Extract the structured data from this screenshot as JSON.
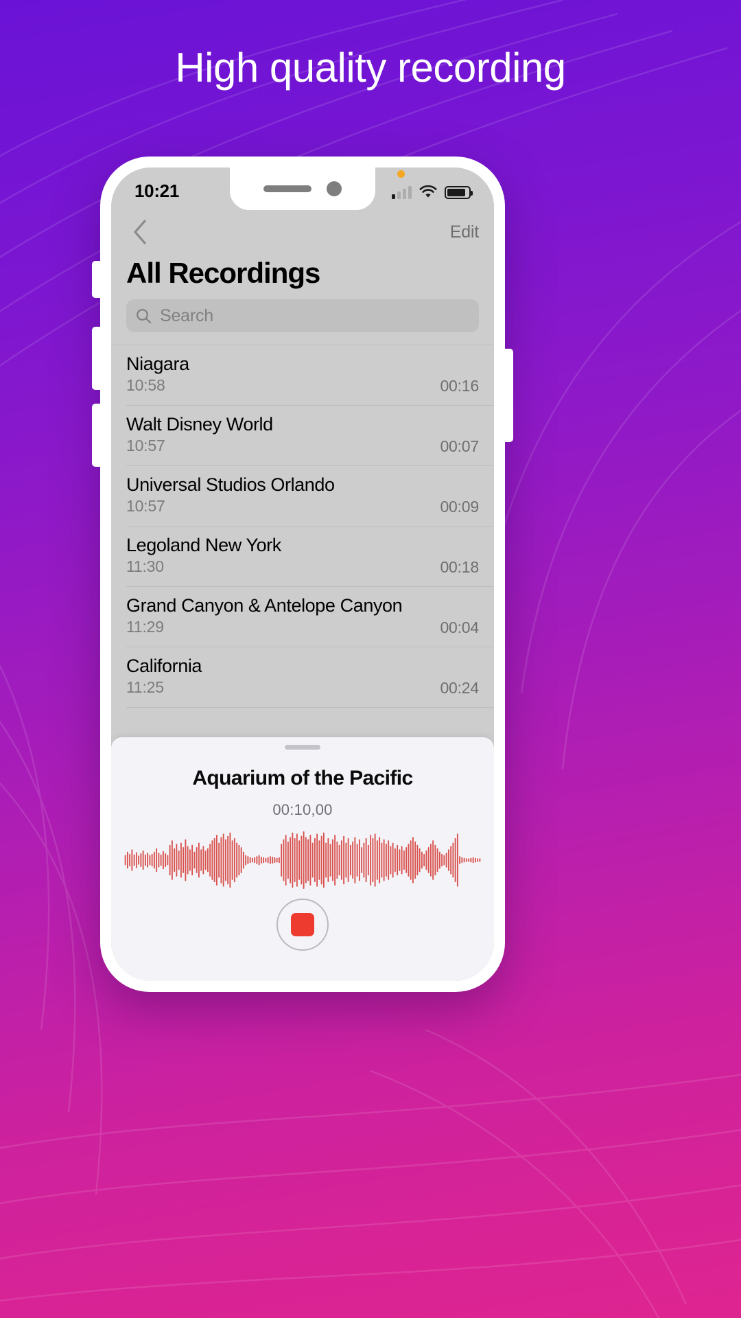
{
  "headline": "High quality recording",
  "colors": {
    "bg_top": "#6a13d6",
    "bg_bottom": "#de2490",
    "accent_red": "#ed3b2f",
    "waveform_red": "#d9534f",
    "screen_bg": "#cdcdcd",
    "sheet_bg": "#f4f4f8",
    "status_orange": "#f5a623"
  },
  "status_bar": {
    "time": "10:21",
    "recording_indicator": "orange-dot",
    "cellular_icon": "signal-bars",
    "wifi_icon": "wifi-icon",
    "battery_icon": "battery-icon",
    "battery_level": 86
  },
  "navbar": {
    "back_icon": "chevron-left-icon",
    "edit_label": "Edit"
  },
  "page_title": "All Recordings",
  "search": {
    "icon": "search-icon",
    "placeholder": "Search",
    "value": ""
  },
  "recordings": [
    {
      "title": "Niagara",
      "time": "10:58",
      "duration": "00:16"
    },
    {
      "title": "Walt Disney World",
      "time": "10:57",
      "duration": "00:07"
    },
    {
      "title": "Universal Studios Orlando",
      "time": "10:57",
      "duration": "00:09"
    },
    {
      "title": "Legoland New York",
      "time": "11:30",
      "duration": "00:18"
    },
    {
      "title": "Grand Canyon & Antelope Canyon",
      "time": "11:29",
      "duration": "00:04"
    },
    {
      "title": "California",
      "time": "11:25",
      "duration": "00:24"
    }
  ],
  "sheet": {
    "handle": "drag-handle",
    "title": "Aquarium of the Pacific",
    "timer": "00:10,00",
    "record_button_icon": "stop-square-icon",
    "waveform_bars": [
      8,
      14,
      10,
      18,
      9,
      13,
      7,
      11,
      16,
      9,
      12,
      8,
      10,
      14,
      20,
      12,
      9,
      15,
      11,
      8,
      26,
      34,
      20,
      28,
      16,
      30,
      22,
      36,
      24,
      18,
      26,
      14,
      22,
      30,
      18,
      24,
      16,
      20,
      28,
      34,
      38,
      44,
      30,
      40,
      46,
      36,
      42,
      48,
      34,
      38,
      30,
      26,
      22,
      14,
      8,
      6,
      4,
      3,
      4,
      6,
      8,
      5,
      4,
      3,
      4,
      6,
      5,
      4,
      3,
      4,
      28,
      36,
      44,
      32,
      40,
      48,
      38,
      46,
      34,
      42,
      50,
      40,
      36,
      44,
      30,
      38,
      46,
      34,
      42,
      48,
      30,
      38,
      28,
      36,
      44,
      32,
      26,
      34,
      42,
      30,
      38,
      26,
      32,
      40,
      28,
      36,
      22,
      30,
      38,
      26,
      44,
      38,
      46,
      34,
      40,
      30,
      36,
      28,
      34,
      24,
      30,
      20,
      26,
      18,
      24,
      16,
      22,
      28,
      34,
      40,
      32,
      26,
      20,
      14,
      10,
      16,
      22,
      28,
      34,
      26,
      20,
      14,
      10,
      8,
      12,
      18,
      24,
      30,
      38,
      46,
      6,
      4,
      3,
      2,
      2,
      3,
      4,
      3,
      2,
      2
    ]
  }
}
